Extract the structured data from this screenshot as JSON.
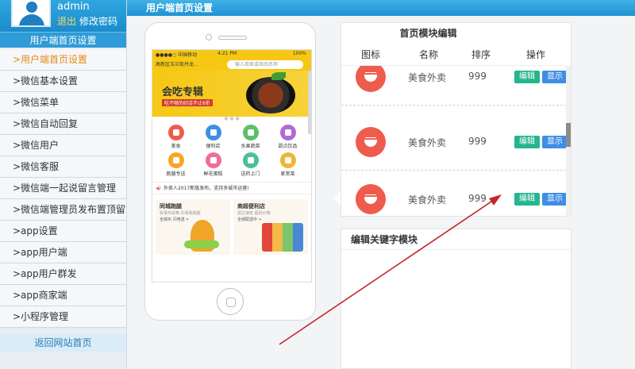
{
  "user": {
    "name": "admin",
    "logout": "退出",
    "change_password": "修改密码"
  },
  "sidebar": {
    "title": "用户端首页设置",
    "items": [
      {
        "label": ">用户端首页设置",
        "active": true
      },
      {
        "label": ">微信基本设置"
      },
      {
        "label": ">微信菜单"
      },
      {
        "label": ">微信自动回复"
      },
      {
        "label": ">微信用户"
      },
      {
        "label": ">微信客服"
      },
      {
        "label": ">微信端一起说留言管理"
      },
      {
        "label": ">微信端管理员发布置顶留言"
      },
      {
        "label": ">app设置"
      },
      {
        "label": ">app用户端"
      },
      {
        "label": ">app用户群发"
      },
      {
        "label": ">app商家端"
      },
      {
        "label": ">小程序管理"
      }
    ],
    "back_home": "返回网站首页"
  },
  "topbar": {
    "title": "用户端首页设置"
  },
  "phone": {
    "status": {
      "left": "●●●●○ 中国移动",
      "time": "4:21 PM",
      "right": "100%"
    },
    "location": "高新区玉兰街丹龙...",
    "search_placeholder": "输入商家或商品名称",
    "banner": {
      "title": "会吃专辑",
      "subtitle": "吃不够的好店不止6折"
    },
    "dots": "● ● ●",
    "icons": [
      {
        "label": "美食",
        "color": "#ee5c4e"
      },
      {
        "label": "便利店",
        "color": "#3f8ee6"
      },
      {
        "label": "水果蔬菜",
        "color": "#5cc06a"
      },
      {
        "label": "甜点饮品",
        "color": "#b26ad4"
      },
      {
        "label": "跑腿专送",
        "color": "#f5a623"
      },
      {
        "label": "鲜花蛋糕",
        "color": "#ee6e9a"
      },
      {
        "label": "送药上门",
        "color": "#4bbf9a"
      },
      {
        "label": "家常菜",
        "color": "#f0b43a"
      }
    ],
    "notice": "外卖人2017新版发布，支持多城市运营!",
    "cards": [
      {
        "title": "同城跑腿",
        "subtitle": "有事你说嘛 办事我跑腿",
        "link": "全城买 闪电送 >"
      },
      {
        "title": "商超便利店",
        "subtitle": "送达速度 超低价格",
        "link": "全城配送中 >"
      }
    ]
  },
  "module_panel": {
    "title": "首页模块编辑",
    "headers": [
      "图标",
      "名称",
      "排序",
      "操作"
    ],
    "rows": [
      {
        "name": "美食外卖",
        "sort": "999",
        "edit": "编辑",
        "show": "显示"
      },
      {
        "name": "美食外卖",
        "sort": "999",
        "edit": "编辑",
        "show": "显示"
      },
      {
        "name": "美食外卖",
        "sort": "999",
        "edit": "编辑",
        "show": "显示"
      }
    ]
  },
  "keyword_panel": {
    "title": "编辑关键字模块"
  },
  "colors": {
    "accent": "#1e92d2",
    "edit_button": "#25b58f",
    "show_button": "#3f8ee6",
    "icon_red": "#ee5c4e",
    "annotation_arrow": "#c0282a"
  }
}
